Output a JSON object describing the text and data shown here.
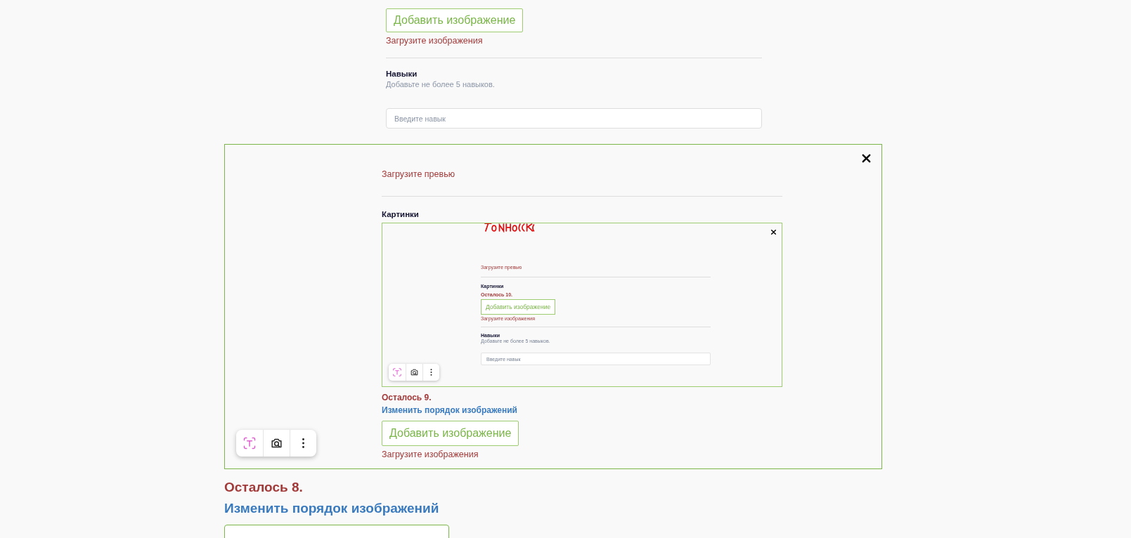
{
  "upload_section": {
    "add_button": "Добавить изображение",
    "error": "Загрузите изображения"
  },
  "skills": {
    "title": "Навыки",
    "hint": "Добавьте не более 5 навыков.",
    "placeholder": "Введите навык"
  },
  "image_preview": {
    "preview_error": "Загрузите превью",
    "images_title": "Картинки",
    "nested_screenshot": {
      "preview_error": "Загрузите превью",
      "images_title": "Картинки",
      "remaining": "Осталось 10.",
      "add_button": "Добавить изображение",
      "error": "Загрузите изображения",
      "skills_title": "Навыки",
      "skills_hint": "Добавьте не более 5 навыков.",
      "skills_placeholder": "Введите навык"
    },
    "remaining": "Осталось 9.",
    "reorder_link": "Изменить порядок изображений",
    "add_button": "Добавить изображение",
    "error": "Загрузите изображения"
  },
  "remaining": "Осталось 8.",
  "reorder_link": "Изменить порядок изображений"
}
